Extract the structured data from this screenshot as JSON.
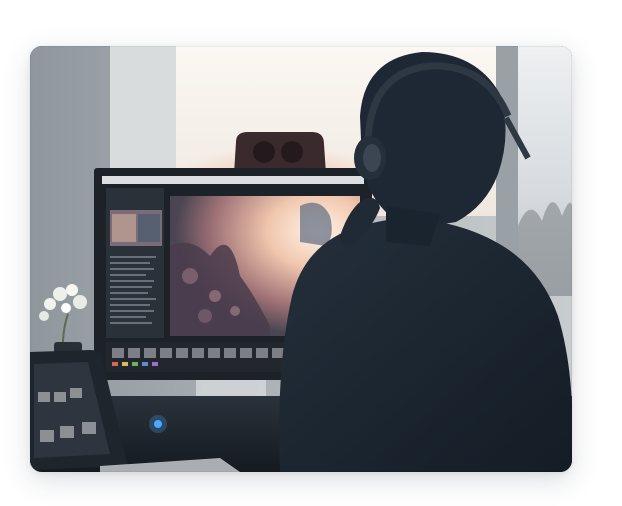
{
  "image": {
    "alt": "",
    "subject": "person-with-headphones-editing-photos",
    "palette": {
      "wall": "#aab2b8",
      "window_light": "#f7f1ea",
      "monitor_bezel": "#1c2228",
      "editor_panel": "#2b3139",
      "sunset_preview": "#e6b79c",
      "silhouette": "#1a2632",
      "speaker": "#3a2a2e",
      "led": "#4aa8ff"
    }
  }
}
